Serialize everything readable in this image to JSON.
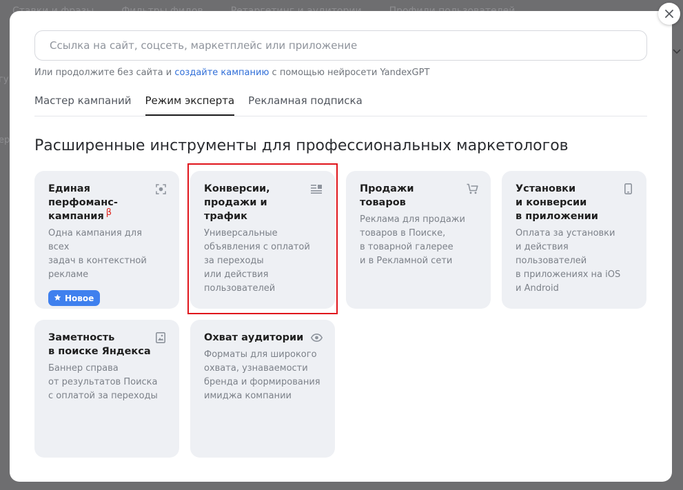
{
  "background": {
    "tabs": [
      "Ставки и фразы",
      "Фильтры фидов",
      "Ретаргетинг и аудитории",
      "Профили пользователей"
    ],
    "fragment_1": "гу",
    "fragment_2": "ер"
  },
  "search": {
    "placeholder": "Ссылка на сайт, соцсеть, маркетплейс или приложение"
  },
  "hint": {
    "prefix": "Или продолжите без сайта и ",
    "link": "создайте кампанию",
    "suffix": " с помощью нейросети YandexGPT"
  },
  "tabs": [
    {
      "label": "Мастер кампаний",
      "active": false
    },
    {
      "label": "Режим эксперта",
      "active": true
    },
    {
      "label": "Рекламная подписка",
      "active": false
    }
  ],
  "heading": "Расширенные инструменты для профессиональных маркетологов",
  "cards": [
    {
      "title": "Единая\nперфоманс-\nкампания",
      "beta": "β",
      "desc": "Одна кампания для всех\nзадач в контекстной\nрекламе",
      "badge": "Новое",
      "icon": "focus-target-icon"
    },
    {
      "title": "Конверсии,\nпродажи и трафик",
      "desc": "Универсальные\nобъявления с оплатой\nза переходы\nили действия\nпользователей",
      "icon": "text-ad-icon",
      "highlighted": true
    },
    {
      "title": "Продажи товаров",
      "desc": "Реклама для продажи\nтоваров в Поиске,\nв товарной галерее\nи в Рекламной сети",
      "icon": "cart-icon"
    },
    {
      "title": "Установки\nи конверсии\nв приложении",
      "desc": "Оплата за установки\nи действия\nпользователей\nв приложениях на iOS\nи Android",
      "icon": "smartphone-icon"
    },
    {
      "title": "Заметность\nв поиске Яндекса",
      "desc": "Баннер справа\nот результатов Поиска\nс оплатой за переходы",
      "icon": "image-icon"
    },
    {
      "title": "Охват аудитории",
      "desc": "Форматы для широкого\nохвата, узнаваемости\nбренда и формирования\nимиджа компании",
      "icon": "eye-icon"
    }
  ],
  "colors": {
    "highlight": "#e0141b",
    "badge": "#3f80ee",
    "link": "#2f6ed8",
    "beta": "#e0271f",
    "card_bg": "#eef0f4"
  }
}
